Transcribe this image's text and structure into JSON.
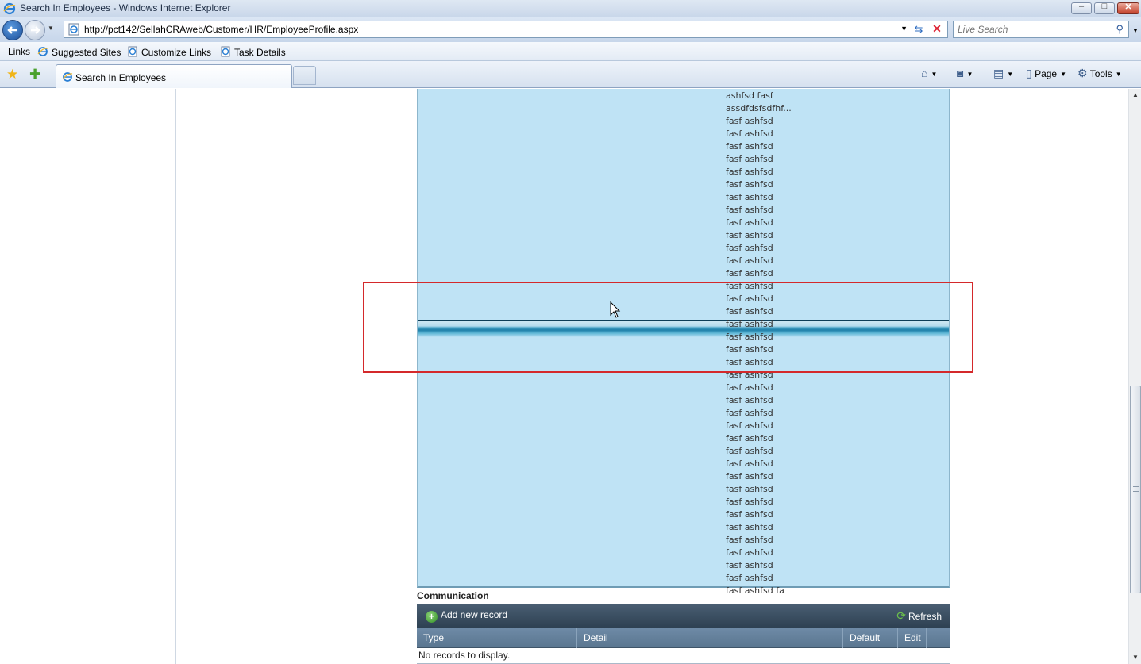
{
  "window": {
    "title": "Search In Employees - Windows Internet Explorer",
    "minimize": "–",
    "maximize": "□",
    "close": "✕"
  },
  "address": {
    "url": "http://pct142/SellahCRAweb/Customer/HR/EmployeeProfile.aspx",
    "search_placeholder": "Live Search"
  },
  "links_bar": {
    "links_label": "Links",
    "items": [
      "Suggested Sites",
      "Customize Links",
      "Task Details"
    ]
  },
  "tabs": {
    "active_tab": "Search In Employees"
  },
  "command_bar": {
    "page": "Page",
    "tools": "Tools"
  },
  "list": {
    "items": [
      "ashfsd fasf",
      "assdfdsfsdfhf...",
      "fasf ashfsd",
      "fasf ashfsd",
      "fasf ashfsd",
      "fasf ashfsd",
      "fasf ashfsd",
      "fasf ashfsd",
      "fasf ashfsd",
      "fasf ashfsd",
      "fasf ashfsd",
      "fasf ashfsd",
      "fasf ashfsd",
      "fasf ashfsd",
      "fasf ashfsd",
      "fasf ashfsd",
      "fasf ashfsd",
      "fasf ashfsd",
      "fasf ashfsd",
      "fasf ashfsd",
      "fasf ashfsd",
      "fasf ashfsd",
      "fasf ashfsd",
      "fasf ashfsd",
      "fasf ashfsd",
      "fasf ashfsd",
      "fasf ashfsd",
      "fasf ashfsd",
      "fasf ashfsd",
      "fasf ashfsd",
      "fasf ashfsd",
      "fasf ashfsd",
      "fasf ashfsd",
      "fasf ashfsd",
      "fasf ashfsd",
      "fasf ashfsd",
      "fasf ashfsd",
      "fasf ashfsd",
      "fasf ashfsd",
      "fasf ashfsd fa"
    ]
  },
  "communication": {
    "title": "Communication",
    "add_new_record": "Add new record",
    "refresh": "Refresh",
    "columns": [
      "Type",
      "Detail",
      "Default",
      "Edit"
    ],
    "empty_message": "No records to display."
  },
  "colors": {
    "list_background": "#bfe3f5",
    "highlight_border": "#d4292b",
    "toolbar_dark": "#2e4152"
  }
}
